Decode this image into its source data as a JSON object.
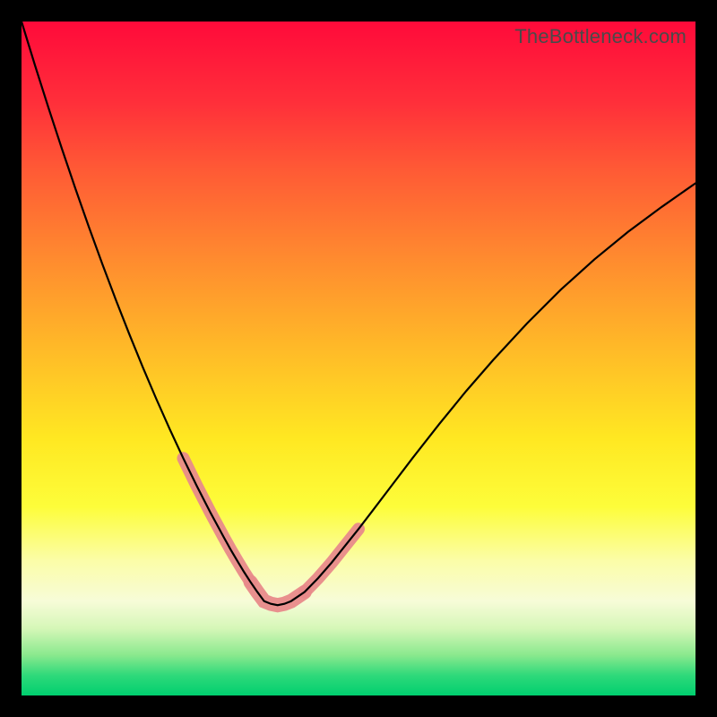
{
  "watermark": "TheBottleneck.com",
  "colors": {
    "frame_bg": "#000000",
    "highlight": "#e88a8a",
    "curve": "#000000"
  },
  "chart_data": {
    "type": "line",
    "title": "",
    "xlabel": "",
    "ylabel": "",
    "xlim": [
      0,
      100
    ],
    "ylim": [
      0,
      100
    ],
    "x": [
      0,
      2,
      4,
      6,
      8,
      10,
      12,
      14,
      16,
      18,
      20,
      22,
      24,
      26,
      28,
      29,
      30,
      31,
      32,
      33,
      34,
      35,
      36,
      37,
      38,
      39,
      40,
      42,
      44,
      46,
      48,
      50,
      52,
      55,
      58,
      62,
      66,
      70,
      75,
      80,
      85,
      90,
      95,
      100
    ],
    "values": [
      100.0,
      93.5,
      87.2,
      81.1,
      75.2,
      69.5,
      64.0,
      58.7,
      53.6,
      48.7,
      44.0,
      39.5,
      35.2,
      31.1,
      27.2,
      25.35,
      23.5,
      21.7,
      20.0,
      18.35,
      16.8,
      15.35,
      14.0,
      13.6,
      13.4,
      13.6,
      14.0,
      15.35,
      17.4,
      19.7,
      22.2,
      24.7,
      27.3,
      31.25,
      35.2,
      40.3,
      45.2,
      49.8,
      55.2,
      60.2,
      64.7,
      68.8,
      72.5,
      76.0
    ],
    "notes": "V-shaped curve with trough near x≈38; highlighted segments marking the lower portions of both branches near the trough; axes and ticks not labeled in image"
  }
}
